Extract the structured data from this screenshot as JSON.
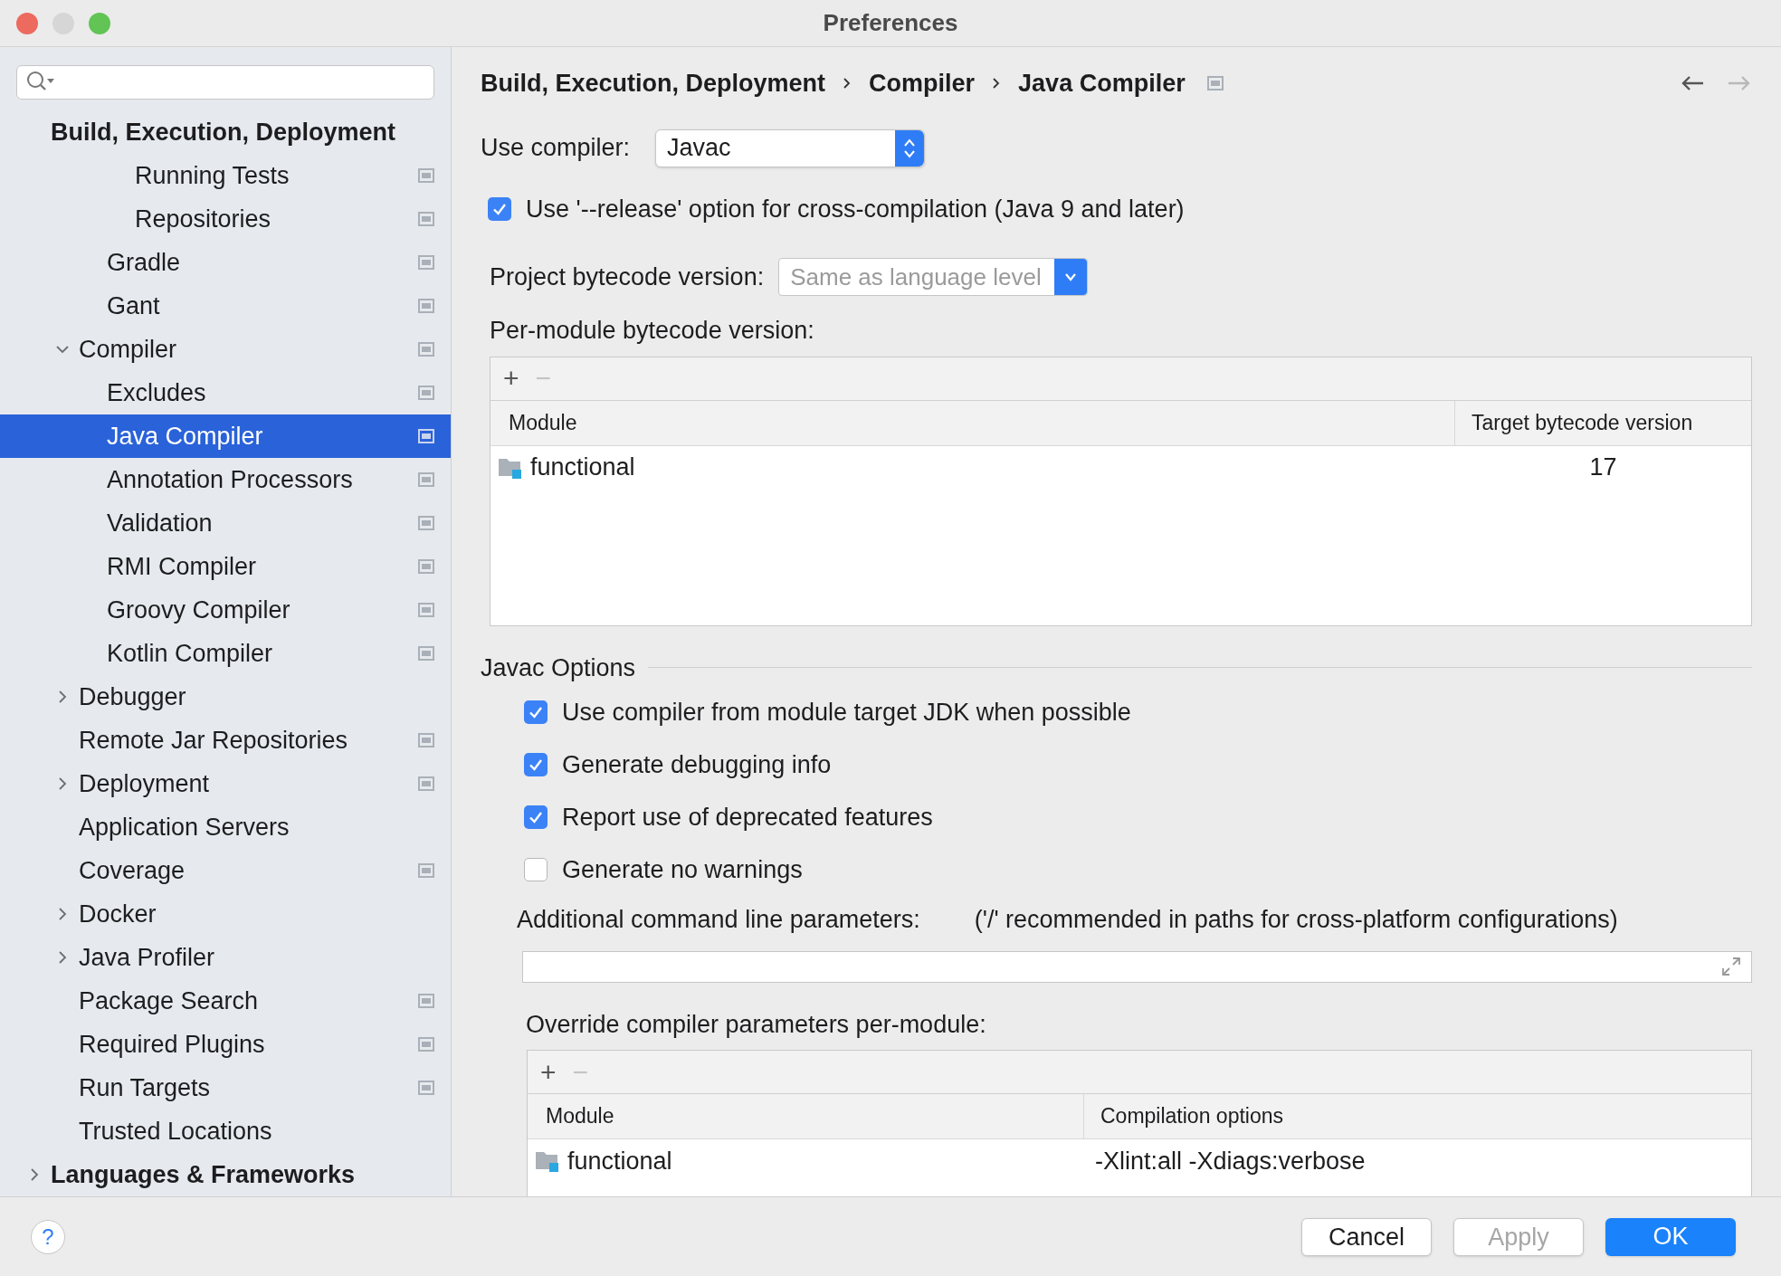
{
  "window": {
    "title": "Preferences"
  },
  "sidebar": {
    "tree": [
      {
        "label": "Build, Execution, Deployment",
        "kind": "section",
        "selected": false,
        "page_icon": false,
        "children": [
          {
            "children": [
              {
                "children": [
                  {
                    "label": "Running Tests",
                    "selected": false,
                    "page_icon": true
                  },
                  {
                    "label": "Repositories",
                    "selected": false,
                    "page_icon": true
                  }
                ]
              },
              {
                "label": "Gradle",
                "selected": false,
                "page_icon": true
              },
              {
                "label": "Gant",
                "selected": false,
                "page_icon": true
              }
            ]
          },
          {
            "label": "Compiler",
            "expanded": true,
            "selected": false,
            "page_icon": true,
            "children": [
              {
                "label": "Excludes",
                "selected": false,
                "page_icon": true
              },
              {
                "label": "Java Compiler",
                "selected": true,
                "page_icon": true
              },
              {
                "label": "Annotation Processors",
                "selected": false,
                "page_icon": true
              },
              {
                "label": "Validation",
                "selected": false,
                "page_icon": true
              },
              {
                "label": "RMI Compiler",
                "selected": false,
                "page_icon": true
              },
              {
                "label": "Groovy Compiler",
                "selected": false,
                "page_icon": true
              },
              {
                "label": "Kotlin Compiler",
                "selected": false,
                "page_icon": true
              }
            ]
          },
          {
            "label": "Debugger",
            "expanded": false,
            "selected": false,
            "page_icon": false
          },
          {
            "label": "Remote Jar Repositories",
            "selected": false,
            "page_icon": true
          },
          {
            "label": "Deployment",
            "expanded": false,
            "selected": false,
            "page_icon": true
          },
          {
            "label": "Application Servers",
            "selected": false,
            "page_icon": false
          },
          {
            "label": "Coverage",
            "selected": false,
            "page_icon": true
          },
          {
            "label": "Docker",
            "expanded": false,
            "selected": false,
            "page_icon": false
          },
          {
            "label": "Java Profiler",
            "expanded": false,
            "selected": false,
            "page_icon": false
          },
          {
            "label": "Package Search",
            "selected": false,
            "page_icon": true
          },
          {
            "label": "Required Plugins",
            "selected": false,
            "page_icon": true
          },
          {
            "label": "Run Targets",
            "selected": false,
            "page_icon": true
          },
          {
            "label": "Trusted Locations",
            "selected": false,
            "page_icon": false
          }
        ]
      },
      {
        "label": "Languages & Frameworks",
        "kind": "section",
        "expanded": false,
        "selected": false,
        "page_icon": false
      }
    ]
  },
  "breadcrumb": [
    "Build, Execution, Deployment",
    "Compiler",
    "Java Compiler"
  ],
  "use_compiler": {
    "label": "Use compiler:",
    "value": "Javac"
  },
  "release_option": {
    "label": "Use '--release' option for cross-compilation (Java 9 and later)",
    "checked": true
  },
  "project_bytecode": {
    "label": "Project bytecode version:",
    "placeholder": "Same as language level"
  },
  "per_module": {
    "label": "Per-module bytecode version:",
    "add": "+",
    "remove": "−",
    "remove_disabled": true,
    "columns": [
      "Module",
      "Target bytecode version"
    ],
    "rows": [
      [
        "functional",
        "17"
      ]
    ]
  },
  "javac_options": {
    "title": "Javac Options",
    "checkboxes": [
      {
        "label": "Use compiler from module target JDK when possible",
        "checked": true
      },
      {
        "label": "Generate debugging info",
        "checked": true
      },
      {
        "label": "Report use of deprecated features",
        "checked": true
      },
      {
        "label": "Generate no warnings",
        "checked": false
      }
    ],
    "additional": {
      "label": "Additional command line parameters:",
      "hint": "('/' recommended in paths for cross-platform configurations)"
    },
    "override": {
      "label": "Override compiler parameters per-module:",
      "add": "+",
      "remove": "−",
      "remove_disabled": true,
      "columns": [
        "Module",
        "Compilation options"
      ],
      "rows": [
        [
          "functional",
          "-Xlint:all -Xdiags:verbose"
        ]
      ]
    }
  },
  "buttons": [
    {
      "label": "Cancel",
      "kind": "normal",
      "disabled": false
    },
    {
      "label": "Apply",
      "kind": "normal",
      "disabled": true
    },
    {
      "label": "OK",
      "kind": "default",
      "disabled": false
    }
  ],
  "help": "?"
}
